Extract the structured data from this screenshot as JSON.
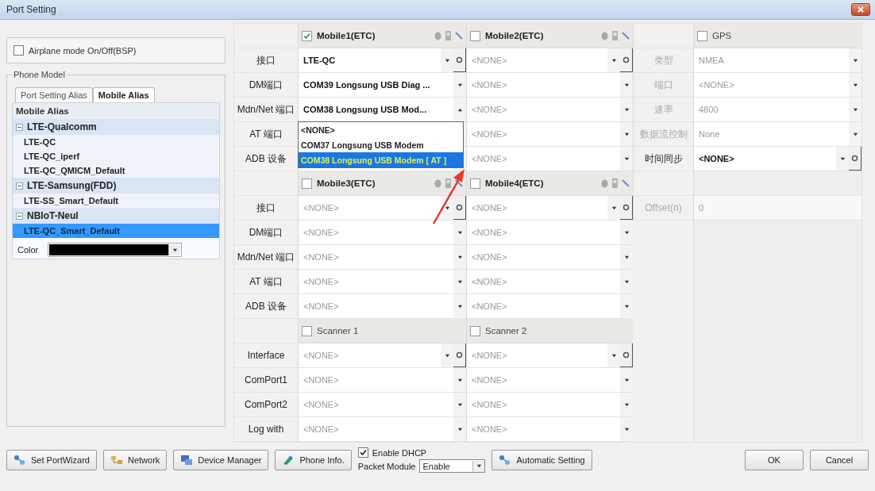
{
  "window": {
    "title": "Port Setting"
  },
  "airplane_mode": {
    "label": "Airplane mode On/Off(BSP)",
    "checked": false
  },
  "phone_model": {
    "title": "Phone Model",
    "tabs": [
      {
        "label": "Port Setting Alias",
        "selected": false
      },
      {
        "label": "Mobile Alias",
        "selected": true
      }
    ],
    "tree": {
      "header": "Mobile Alias",
      "groups": [
        {
          "label": "LTE-Qualcomm",
          "expanded": true,
          "children": [
            {
              "label": "LTE-QC",
              "selected": false
            },
            {
              "label": "LTE-QC_iperf",
              "selected": false
            },
            {
              "label": "LTE-QC_QMICM_Default",
              "selected": false
            }
          ]
        },
        {
          "label": "LTE-Samsung(FDD)",
          "expanded": true,
          "children": [
            {
              "label": "LTE-SS_Smart_Default",
              "selected": false
            }
          ]
        },
        {
          "label": "NBIoT-Neul",
          "expanded": true,
          "children": [
            {
              "label": "LTE-QC_Smart_Default",
              "selected": true
            }
          ]
        }
      ]
    },
    "color": {
      "label": "Color"
    }
  },
  "port_grid": {
    "sections": [
      {
        "kind": "mobile",
        "headers": [
          {
            "label": "Mobile1(ETC)",
            "checked": true
          },
          {
            "label": "Mobile2(ETC)",
            "checked": false
          }
        ],
        "rows": [
          {
            "label": "接口",
            "cells": [
              {
                "value": "LTE-QC",
                "disabled": false,
                "gear": true
              },
              {
                "value": "<NONE>",
                "disabled": true,
                "gear": true
              }
            ]
          },
          {
            "label": "DM端口",
            "cells": [
              {
                "value": "COM39 Longsung USB Diag ...",
                "disabled": false,
                "gear": false
              },
              {
                "value": "<NONE>",
                "disabled": true,
                "gear": false
              }
            ]
          },
          {
            "label": "Mdn/Net 端口",
            "cells": [
              {
                "value": "COM38 Longsung USB Mod...",
                "disabled": false,
                "gear": false,
                "open": true,
                "dropdown": [
                  {
                    "label": "<NONE>",
                    "selected": false
                  },
                  {
                    "label": "COM37 Longsung USB Modem",
                    "selected": false
                  },
                  {
                    "label": "COM38 Longsung USB Modem [ AT ]",
                    "selected": true
                  }
                ]
              },
              {
                "value": "<NONE>",
                "disabled": true,
                "gear": false
              }
            ]
          },
          {
            "label": "AT 端口",
            "cells": [
              {},
              {
                "value": "<NONE>",
                "disabled": true,
                "gear": false
              }
            ]
          },
          {
            "label": "ADB 设备",
            "cells": [
              {},
              {
                "value": "<NONE>",
                "disabled": true,
                "gear": false
              }
            ]
          }
        ]
      },
      {
        "kind": "mobile",
        "headers": [
          {
            "label": "Mobile3(ETC)",
            "checked": false
          },
          {
            "label": "Mobile4(ETC)",
            "checked": false
          }
        ],
        "rows": [
          {
            "label": "接口",
            "cells": [
              {
                "value": "<NONE>",
                "disabled": true,
                "gear": true
              },
              {
                "value": "<NONE>",
                "disabled": true,
                "gear": true
              }
            ]
          },
          {
            "label": "DM端口",
            "cells": [
              {
                "value": "<NONE>",
                "disabled": true,
                "gear": false
              },
              {
                "value": "<NONE>",
                "disabled": true,
                "gear": false
              }
            ]
          },
          {
            "label": "Mdn/Net 端口",
            "cells": [
              {
                "value": "<NONE>",
                "disabled": true,
                "gear": false
              },
              {
                "value": "<NONE>",
                "disabled": true,
                "gear": false
              }
            ]
          },
          {
            "label": "AT 端口",
            "cells": [
              {
                "value": "<NONE>",
                "disabled": true,
                "gear": false
              },
              {
                "value": "<NONE>",
                "disabled": true,
                "gear": false
              }
            ]
          },
          {
            "label": "ADB 设备",
            "cells": [
              {
                "value": "<NONE>",
                "disabled": true,
                "gear": false
              },
              {
                "value": "<NONE>",
                "disabled": true,
                "gear": false
              }
            ]
          }
        ]
      },
      {
        "kind": "scanner",
        "headers": [
          {
            "label": "Scanner 1",
            "checked": false
          },
          {
            "label": "Scanner 2",
            "checked": false
          }
        ],
        "rows": [
          {
            "label": "Interface",
            "cells": [
              {
                "value": "<NONE>",
                "disabled": true,
                "gear": true
              },
              {
                "value": "<NONE>",
                "disabled": true,
                "gear": true
              }
            ]
          },
          {
            "label": "ComPort1",
            "cells": [
              {
                "value": "<NONE>",
                "disabled": true,
                "gear": false
              },
              {
                "value": "<NONE>",
                "disabled": true,
                "gear": false
              }
            ]
          },
          {
            "label": "ComPort2",
            "cells": [
              {
                "value": "<NONE>",
                "disabled": true,
                "gear": false
              },
              {
                "value": "<NONE>",
                "disabled": true,
                "gear": false
              }
            ]
          },
          {
            "label": "Log with",
            "cells": [
              {
                "value": "<NONE>",
                "disabled": true,
                "gear": false
              },
              {
                "value": "<NONE>",
                "disabled": true,
                "gear": false
              }
            ]
          }
        ]
      }
    ]
  },
  "gps": {
    "header": {
      "label": "GPS",
      "checked": false
    },
    "rows": [
      {
        "kind": "select",
        "label": "类型",
        "value": "NMEA",
        "disabled": true,
        "gear": false
      },
      {
        "kind": "select",
        "label": "端口",
        "value": "<NONE>",
        "disabled": true,
        "gear": false
      },
      {
        "kind": "select",
        "label": "速率",
        "value": "4800",
        "disabled": true,
        "gear": false
      },
      {
        "kind": "select",
        "label": "数据流控制",
        "value": "None",
        "disabled": true,
        "gear": false
      },
      {
        "kind": "select",
        "label": "时间同步",
        "value": "<NONE>",
        "disabled": false,
        "gear": true
      },
      {
        "kind": "blank"
      },
      {
        "kind": "text",
        "label": "Offset(n)",
        "value": "0",
        "disabled": true,
        "gear": false
      }
    ]
  },
  "toolbar": {
    "buttons": [
      {
        "label": "Set PortWizard",
        "kind": "wizard"
      },
      {
        "label": "Network",
        "kind": "network"
      },
      {
        "label": "Device Manager",
        "kind": "devices"
      },
      {
        "label": "Phone Info.",
        "kind": "phone"
      }
    ],
    "dhcp": {
      "label": "Enable DHCP",
      "checked": true
    },
    "packet_module": {
      "label": "Packet Module",
      "value": "Enable"
    },
    "auto_button": {
      "label": "Automatic Setting",
      "kind": "wizard"
    },
    "dialog_buttons": [
      "OK",
      "Cancel"
    ]
  }
}
